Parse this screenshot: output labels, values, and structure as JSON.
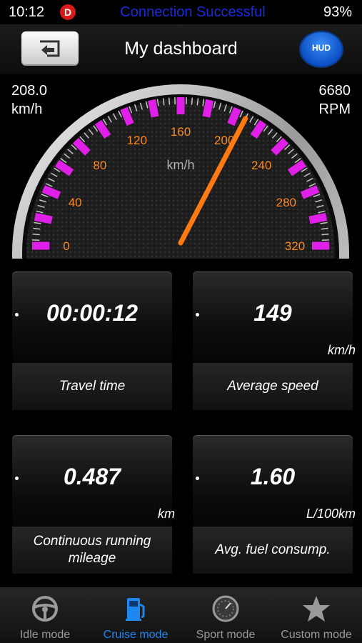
{
  "status_bar": {
    "time": "10:12",
    "badge": "D",
    "connection": "Connection Successful",
    "battery": "93%"
  },
  "header": {
    "title": "My dashboard",
    "hud_label": "HUD"
  },
  "gauge": {
    "speed_value": "208.0",
    "speed_unit": "km/h",
    "rpm_value": "6680",
    "rpm_unit": "RPM",
    "center_unit": "km/h",
    "needle_speed": 208,
    "scale_max": 320,
    "tick_labels": [
      "0",
      "40",
      "80",
      "120",
      "160",
      "200",
      "240",
      "280",
      "320"
    ],
    "colors": {
      "accent": "#e020e8",
      "labels": "#ff8a1e",
      "needle": "#ff7a10"
    }
  },
  "cards": [
    {
      "value": "00:00:12",
      "unit": "",
      "label": "Travel time"
    },
    {
      "value": "149",
      "unit": "km/h",
      "label": "Average speed"
    },
    {
      "value": "0.487",
      "unit": "km",
      "label": "Continuous running mileage"
    },
    {
      "value": "1.60",
      "unit": "L/100km",
      "label": "Avg. fuel consump."
    }
  ],
  "tabs": [
    {
      "label": "Idle mode",
      "icon": "steering-wheel-icon",
      "active": false
    },
    {
      "label": "Cruise mode",
      "icon": "fuel-pump-icon",
      "active": true
    },
    {
      "label": "Sport mode",
      "icon": "speedometer-icon",
      "active": false
    },
    {
      "label": "Custom mode",
      "icon": "star-icon",
      "active": false
    }
  ]
}
